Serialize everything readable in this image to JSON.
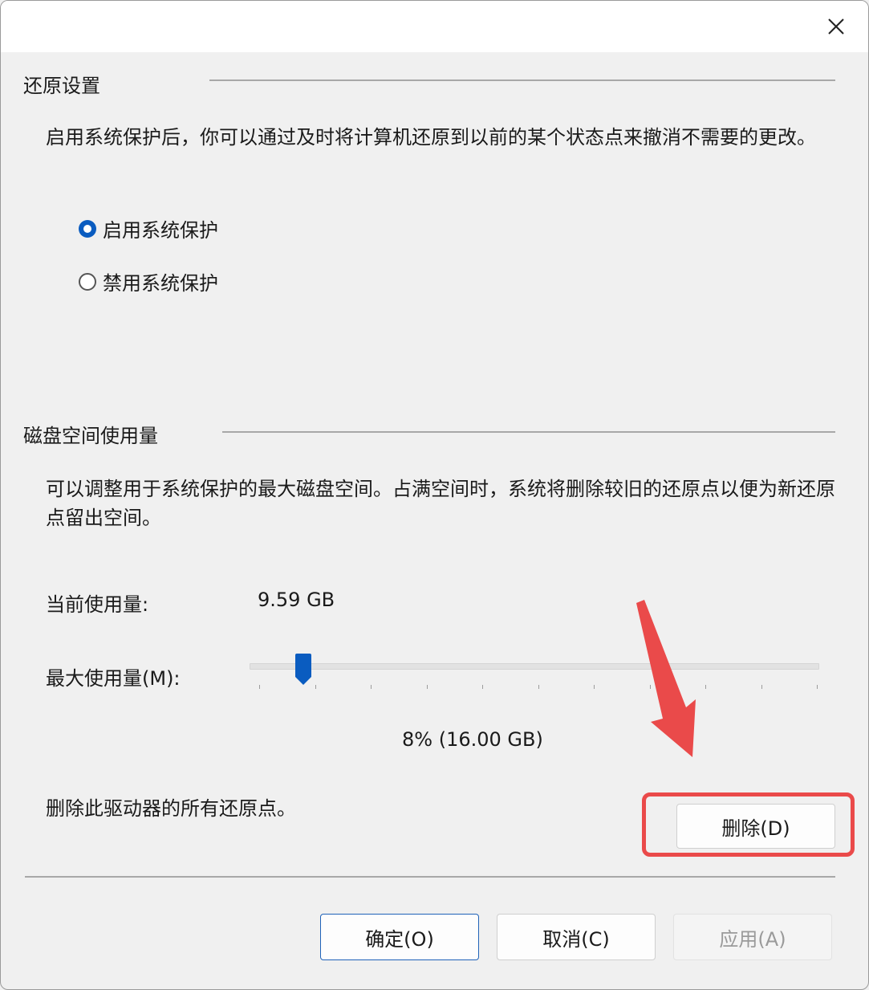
{
  "dialog": {
    "restore_section": {
      "title": "还原设置",
      "description": "启用系统保护后，你可以通过及时将计算机还原到以前的某个状态点来撤消不需要的更改。",
      "options": [
        {
          "label": "启用系统保护",
          "checked": true
        },
        {
          "label": "禁用系统保护",
          "checked": false
        }
      ]
    },
    "disk_section": {
      "title": "磁盘空间使用量",
      "description": "可以调整用于系统保护的最大磁盘空间。占满空间时，系统将删除较旧的还原点以便为新还原点留出空间。",
      "current_usage_label": "当前使用量:",
      "current_usage_value": "9.59 GB",
      "max_usage_label": "最大使用量(M):",
      "max_usage_readout": "8% (16.00 GB)",
      "slider_level_percent": 8,
      "delete_text": "删除此驱动器的所有还原点。",
      "delete_button": "删除(D)"
    },
    "footer": {
      "ok_button": "确定(O)",
      "cancel_button": "取消(C)",
      "apply_button": "应用(A)"
    }
  },
  "colors": {
    "accent": "#0a5cc0",
    "annotation": "#ea4a4a"
  },
  "icons": {
    "close": "close-icon",
    "annotation_arrow": "arrow-down-icon"
  }
}
